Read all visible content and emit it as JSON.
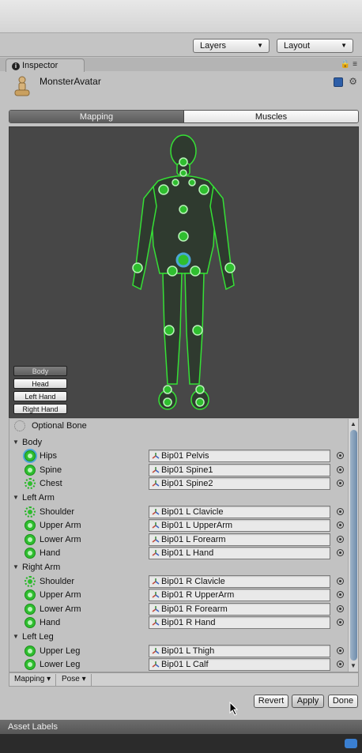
{
  "toolbar": {
    "layers": "Layers",
    "layout": "Layout"
  },
  "tab": {
    "label": "Inspector"
  },
  "header": {
    "title": "MonsterAvatar"
  },
  "segments": {
    "mapping": "Mapping",
    "muscles": "Muscles"
  },
  "view_buttons": [
    {
      "label": "Body",
      "active": true
    },
    {
      "label": "Head",
      "active": false
    },
    {
      "label": "Left Hand",
      "active": false
    },
    {
      "label": "Right Hand",
      "active": false
    }
  ],
  "optional_bone": "Optional Bone",
  "groups": [
    {
      "label": "Body",
      "bones": [
        {
          "label": "Hips",
          "value": "Bip01 Pelvis",
          "style": "sel"
        },
        {
          "label": "Spine",
          "value": "Bip01 Spine1",
          "style": "solid"
        },
        {
          "label": "Chest",
          "value": "Bip01 Spine2",
          "style": "dashed"
        }
      ]
    },
    {
      "label": "Left Arm",
      "bones": [
        {
          "label": "Shoulder",
          "value": "Bip01 L Clavicle",
          "style": "dashed"
        },
        {
          "label": "Upper Arm",
          "value": "Bip01 L UpperArm",
          "style": "solid"
        },
        {
          "label": "Lower Arm",
          "value": "Bip01 L Forearm",
          "style": "solid"
        },
        {
          "label": "Hand",
          "value": "Bip01 L Hand",
          "style": "solid"
        }
      ]
    },
    {
      "label": "Right Arm",
      "bones": [
        {
          "label": "Shoulder",
          "value": "Bip01 R Clavicle",
          "style": "dashed"
        },
        {
          "label": "Upper Arm",
          "value": "Bip01 R UpperArm",
          "style": "solid"
        },
        {
          "label": "Lower Arm",
          "value": "Bip01 R Forearm",
          "style": "solid"
        },
        {
          "label": "Hand",
          "value": "Bip01 R Hand",
          "style": "solid"
        }
      ]
    },
    {
      "label": "Left Leg",
      "bones": [
        {
          "label": "Upper Leg",
          "value": "Bip01 L Thigh",
          "style": "solid"
        },
        {
          "label": "Lower Leg",
          "value": "Bip01 L Calf",
          "style": "solid"
        }
      ]
    }
  ],
  "bottom": {
    "mapping": "Mapping",
    "pose": "Pose"
  },
  "actions": {
    "revert": "Revert",
    "apply": "Apply",
    "done": "Done"
  },
  "asset_labels": "Asset Labels",
  "colors": {
    "joint_green": "#2fbe2f",
    "highlight_blue": "#4aa6d6"
  }
}
